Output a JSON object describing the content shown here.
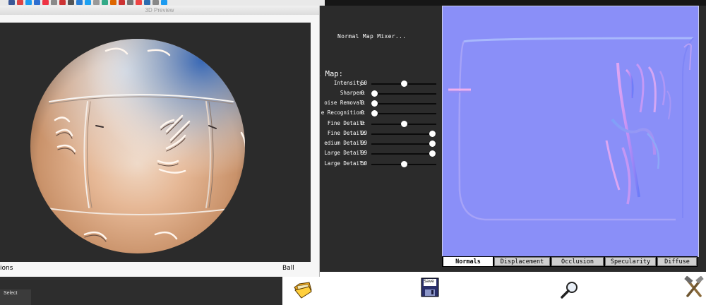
{
  "preview_window": {
    "title": "3D Preview",
    "mode_label": "ions",
    "shape_label": "Ball",
    "viewport_background": "#2b2b2b"
  },
  "mixer": {
    "title": "Normal Map Mixer...",
    "section_label": "l Map:",
    "sliders": [
      {
        "label": "Intensity:",
        "value": "50",
        "fraction": 0.5
      },
      {
        "label": "Sharpen:",
        "value": "0",
        "fraction": 0.0
      },
      {
        "label": "oise Removal:",
        "value": "0",
        "fraction": 0.0
      },
      {
        "label": "e Recognition:",
        "value": "0",
        "fraction": 0.0
      },
      {
        "label": "Fine Detail:",
        "value": "0",
        "fraction": 0.5
      },
      {
        "label": "Fine Detail:",
        "value": "99",
        "fraction": 0.99
      },
      {
        "label": "edium Detail:",
        "value": "99",
        "fraction": 0.99
      },
      {
        "label": "Large Detail:",
        "value": "99",
        "fraction": 0.99
      },
      {
        "label": "Large Detail:",
        "value": "50",
        "fraction": 0.5
      }
    ]
  },
  "tabs": [
    {
      "label": "Normals",
      "active": true
    },
    {
      "label": "Displacement",
      "active": false
    },
    {
      "label": "Occlusion",
      "active": false
    },
    {
      "label": "Specularity",
      "active": false
    },
    {
      "label": "Diffuse",
      "active": false
    }
  ],
  "toolbar": {
    "open_icon": "folder-open-icon",
    "save_label": "Save",
    "save_icon": "floppy-save-icon",
    "zoom_icon": "magnifier-icon",
    "tools_icon": "hammer-wrench-icon"
  },
  "left_app": {
    "select_label": "Select"
  },
  "colors": {
    "normal_base": "#8a8ff8",
    "ball_light": "#e6e7ec",
    "ball_warm": "#e8b08a",
    "ball_cool": "#3a74c0"
  }
}
